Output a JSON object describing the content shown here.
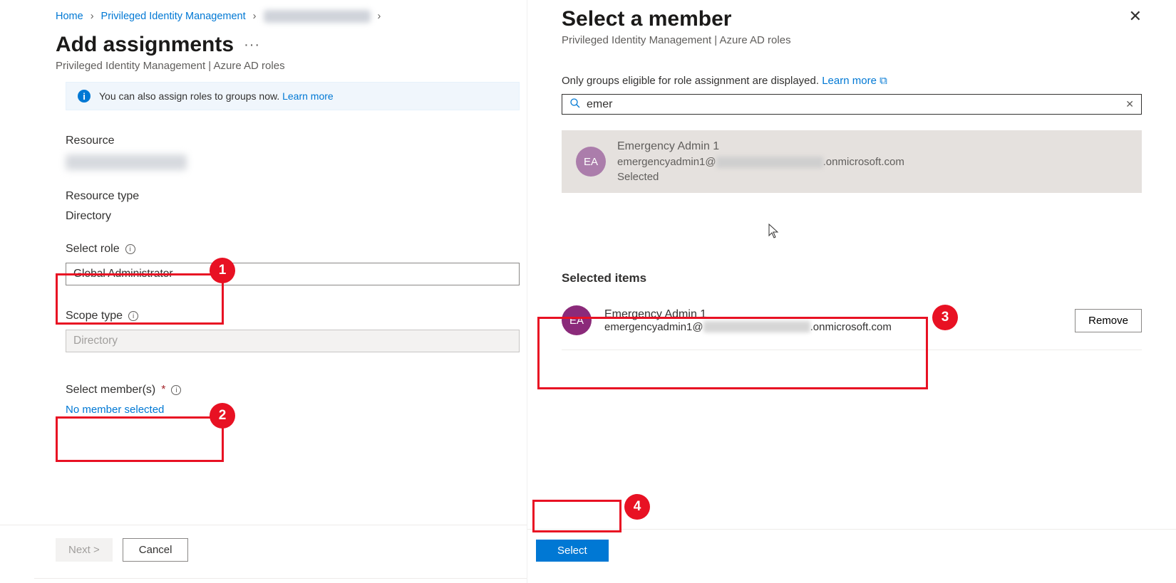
{
  "breadcrumb": {
    "home": "Home",
    "pim": "Privileged Identity Management"
  },
  "page": {
    "title": "Add assignments",
    "subtitle": "Privileged Identity Management | Azure AD roles"
  },
  "banner": {
    "text": "You can also assign roles to groups now.",
    "link": "Learn more"
  },
  "fields": {
    "resource_label": "Resource",
    "rtype_label": "Resource type",
    "rtype_value": "Directory",
    "role_label": "Select role",
    "role_value": "Global Administrator",
    "scope_label": "Scope type",
    "scope_value": "Directory",
    "members_label": "Select member(s)",
    "members_link": "No member selected"
  },
  "footer": {
    "next": "Next >",
    "cancel": "Cancel"
  },
  "panel": {
    "title": "Select a member",
    "subtitle": "Privileged Identity Management | Azure AD roles",
    "help_text": "Only groups eligible for role assignment are displayed.",
    "help_link": "Learn more",
    "search_value": "emer",
    "result": {
      "initials": "EA",
      "name": "Emergency Admin 1",
      "email_prefix": "emergencyadmin1@",
      "email_suffix": ".onmicrosoft.com",
      "state": "Selected"
    },
    "selected_heading": "Selected items",
    "selected": {
      "initials": "EA",
      "name": "Emergency Admin 1",
      "email_prefix": "emergencyadmin1@",
      "email_suffix": ".onmicrosoft.com"
    },
    "remove": "Remove",
    "select_btn": "Select"
  },
  "callouts": {
    "n1": "1",
    "n2": "2",
    "n3": "3",
    "n4": "4"
  }
}
